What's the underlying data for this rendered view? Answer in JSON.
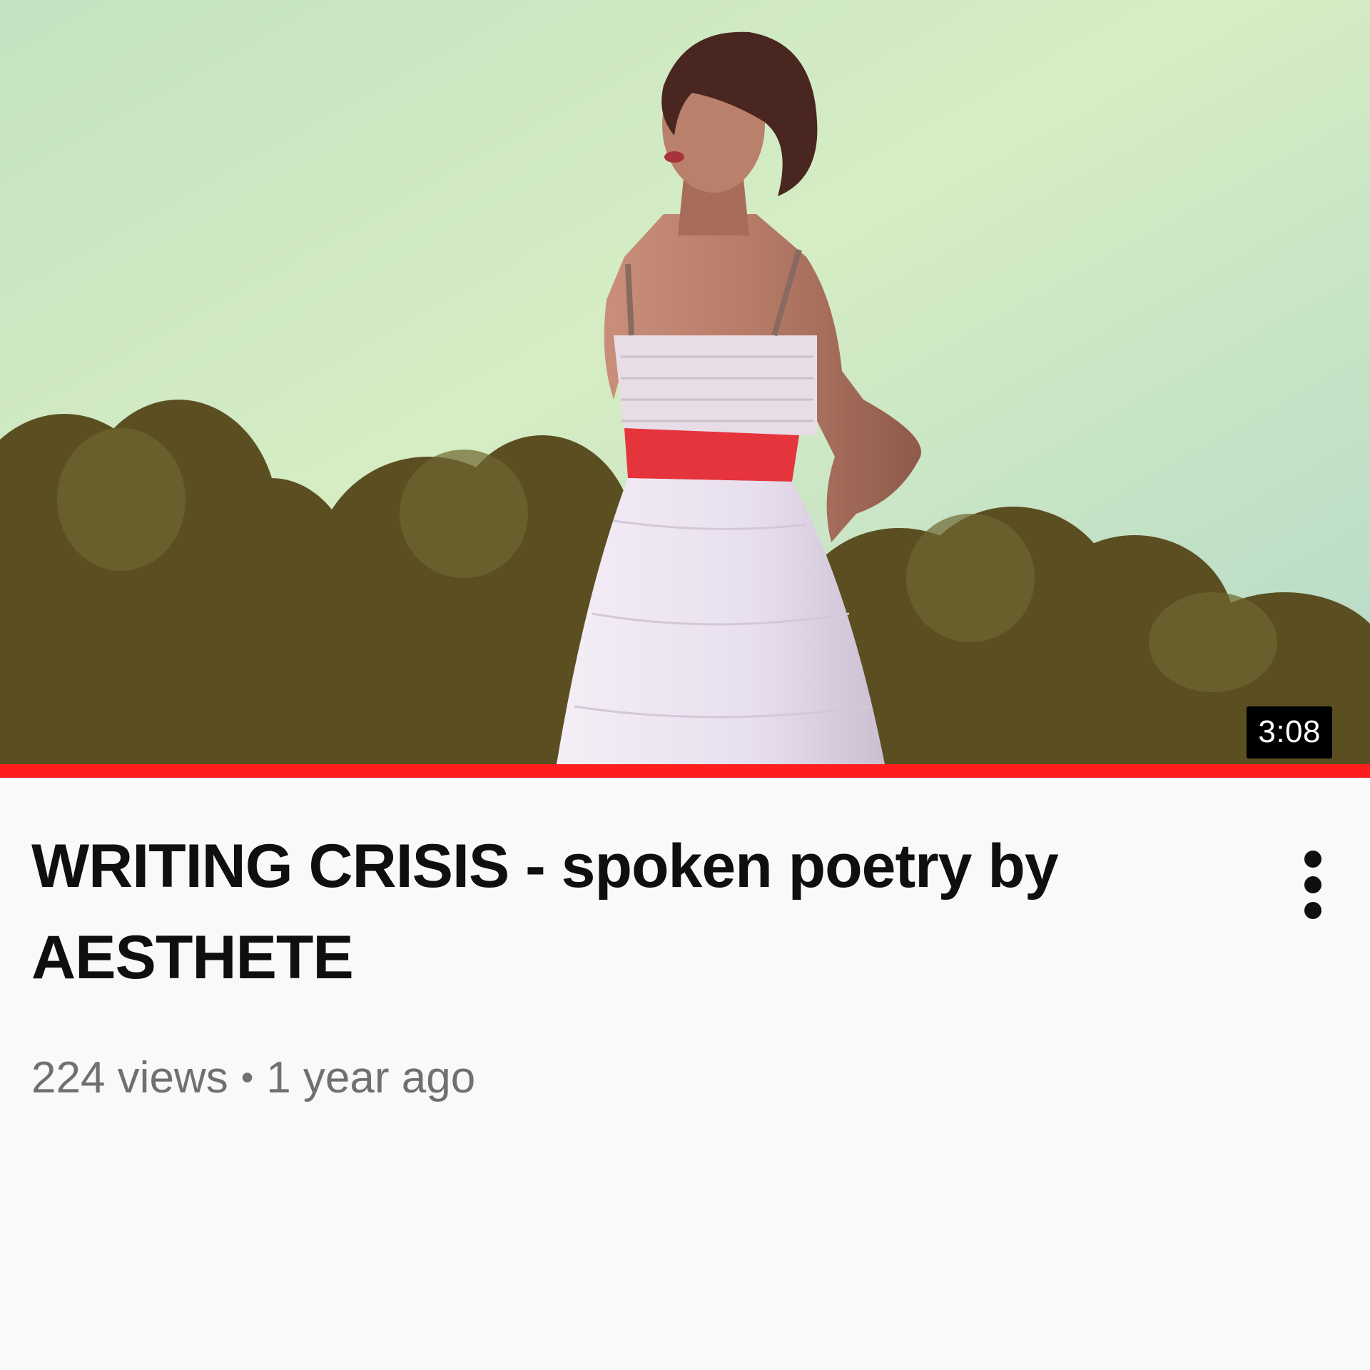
{
  "video": {
    "title": "WRITING CRISIS - spoken poetry by AESTHETE",
    "duration": "3:08",
    "views": "224 views",
    "separator": "•",
    "age": "1 year ago",
    "watched_fraction": 1.0,
    "thumbnail_subject": "woman in white dress with red sash against sky and trees"
  },
  "menu": {
    "icon": "more-vertical-icon"
  },
  "colors": {
    "progress": "#ff1e1e",
    "duration_bg": "#000000",
    "title": "#0f0f0f",
    "meta": "#707070",
    "background": "#f8f9fb"
  }
}
